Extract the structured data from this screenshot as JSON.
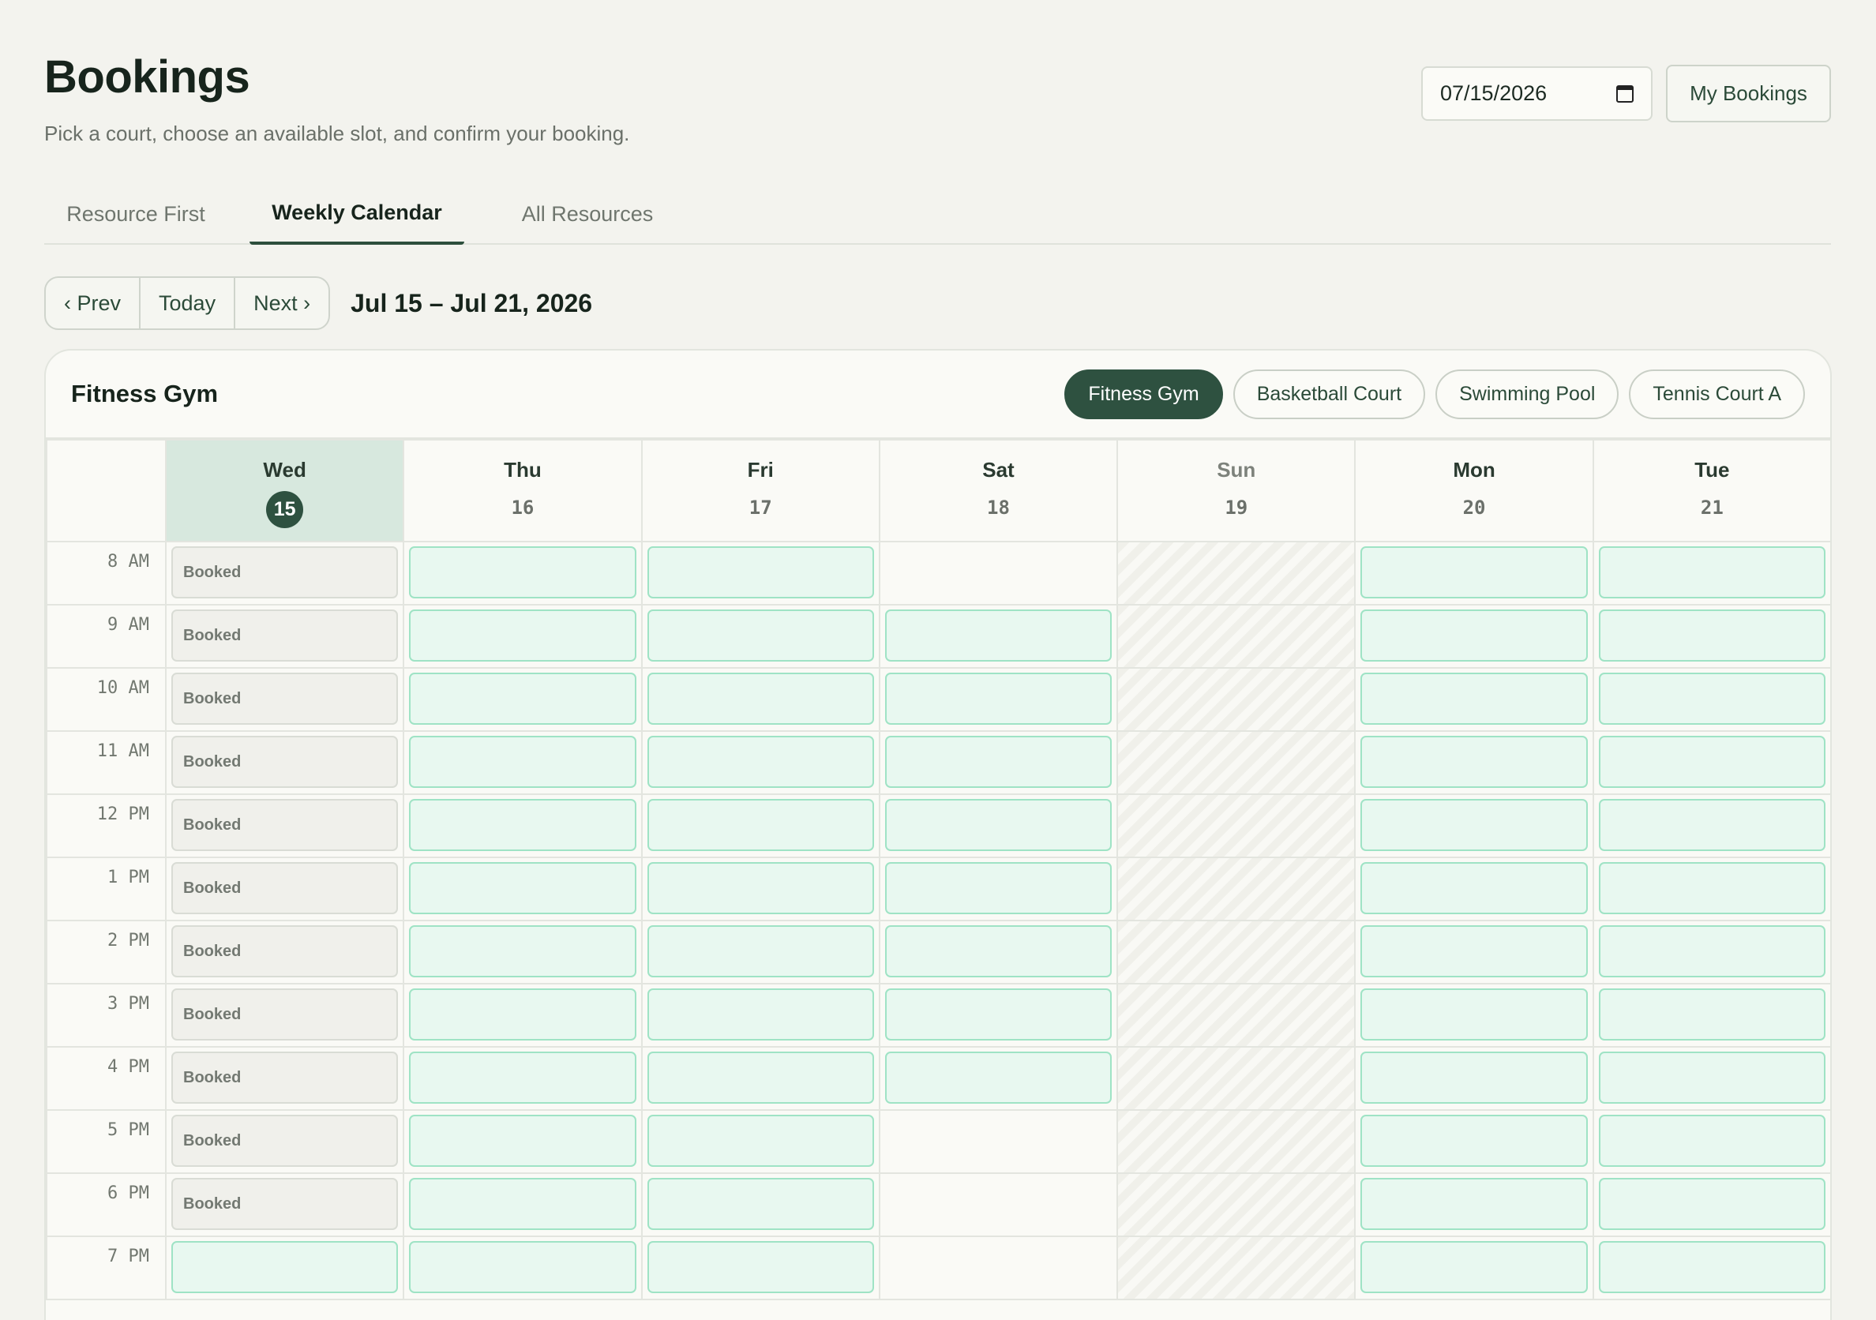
{
  "header": {
    "title": "Bookings",
    "subtitle": "Pick a court, choose an available slot, and confirm your booking."
  },
  "actions": {
    "date_value": "07/15/2026",
    "my_bookings_label": "My Bookings"
  },
  "tabs": [
    {
      "label": "Resource First",
      "active": false
    },
    {
      "label": "Weekly Calendar",
      "active": true
    },
    {
      "label": "All Resources",
      "active": false
    }
  ],
  "week_nav": {
    "prev_label": "‹ Prev",
    "today_label": "Today",
    "next_label": "Next ›",
    "range": "Jul 15 – Jul 21, 2026"
  },
  "calendar": {
    "resource_title": "Fitness Gym",
    "resources": [
      {
        "label": "Fitness Gym",
        "active": true
      },
      {
        "label": "Basketball Court",
        "active": false
      },
      {
        "label": "Swimming Pool",
        "active": false
      },
      {
        "label": "Tennis Court A",
        "active": false
      }
    ],
    "days": [
      {
        "name": "Wed",
        "num": "15",
        "today": true
      },
      {
        "name": "Thu",
        "num": "16"
      },
      {
        "name": "Fri",
        "num": "17"
      },
      {
        "name": "Sat",
        "num": "18"
      },
      {
        "name": "Sun",
        "num": "19",
        "closed": true
      },
      {
        "name": "Mon",
        "num": "20"
      },
      {
        "name": "Tue",
        "num": "21"
      }
    ],
    "booked_label": "Booked",
    "rows": [
      {
        "time": "8 AM",
        "slots": [
          "booked",
          "available",
          "available",
          "none",
          "closed",
          "available",
          "available"
        ]
      },
      {
        "time": "9 AM",
        "slots": [
          "booked",
          "available",
          "available",
          "available",
          "closed",
          "available",
          "available"
        ]
      },
      {
        "time": "10 AM",
        "slots": [
          "booked",
          "available",
          "available",
          "available",
          "closed",
          "available",
          "available"
        ]
      },
      {
        "time": "11 AM",
        "slots": [
          "booked",
          "available",
          "available",
          "available",
          "closed",
          "available",
          "available"
        ]
      },
      {
        "time": "12 PM",
        "slots": [
          "booked",
          "available",
          "available",
          "available",
          "closed",
          "available",
          "available"
        ]
      },
      {
        "time": "1 PM",
        "slots": [
          "booked",
          "available",
          "available",
          "available",
          "closed",
          "available",
          "available"
        ]
      },
      {
        "time": "2 PM",
        "slots": [
          "booked",
          "available",
          "available",
          "available",
          "closed",
          "available",
          "available"
        ]
      },
      {
        "time": "3 PM",
        "slots": [
          "booked",
          "available",
          "available",
          "available",
          "closed",
          "available",
          "available"
        ]
      },
      {
        "time": "4 PM",
        "slots": [
          "booked",
          "available",
          "available",
          "available",
          "closed",
          "available",
          "available"
        ]
      },
      {
        "time": "5 PM",
        "slots": [
          "booked",
          "available",
          "available",
          "none",
          "closed",
          "available",
          "available"
        ]
      },
      {
        "time": "6 PM",
        "slots": [
          "booked",
          "available",
          "available",
          "none",
          "closed",
          "available",
          "available"
        ]
      },
      {
        "time": "7 PM",
        "slots": [
          "available",
          "available",
          "available",
          "none",
          "closed",
          "available",
          "available"
        ]
      }
    ]
  },
  "colors": {
    "accent": "#2e5140",
    "available_fill": "#e8f8f0",
    "available_border": "#9fe3c5",
    "today_column": "#d7e8de"
  }
}
